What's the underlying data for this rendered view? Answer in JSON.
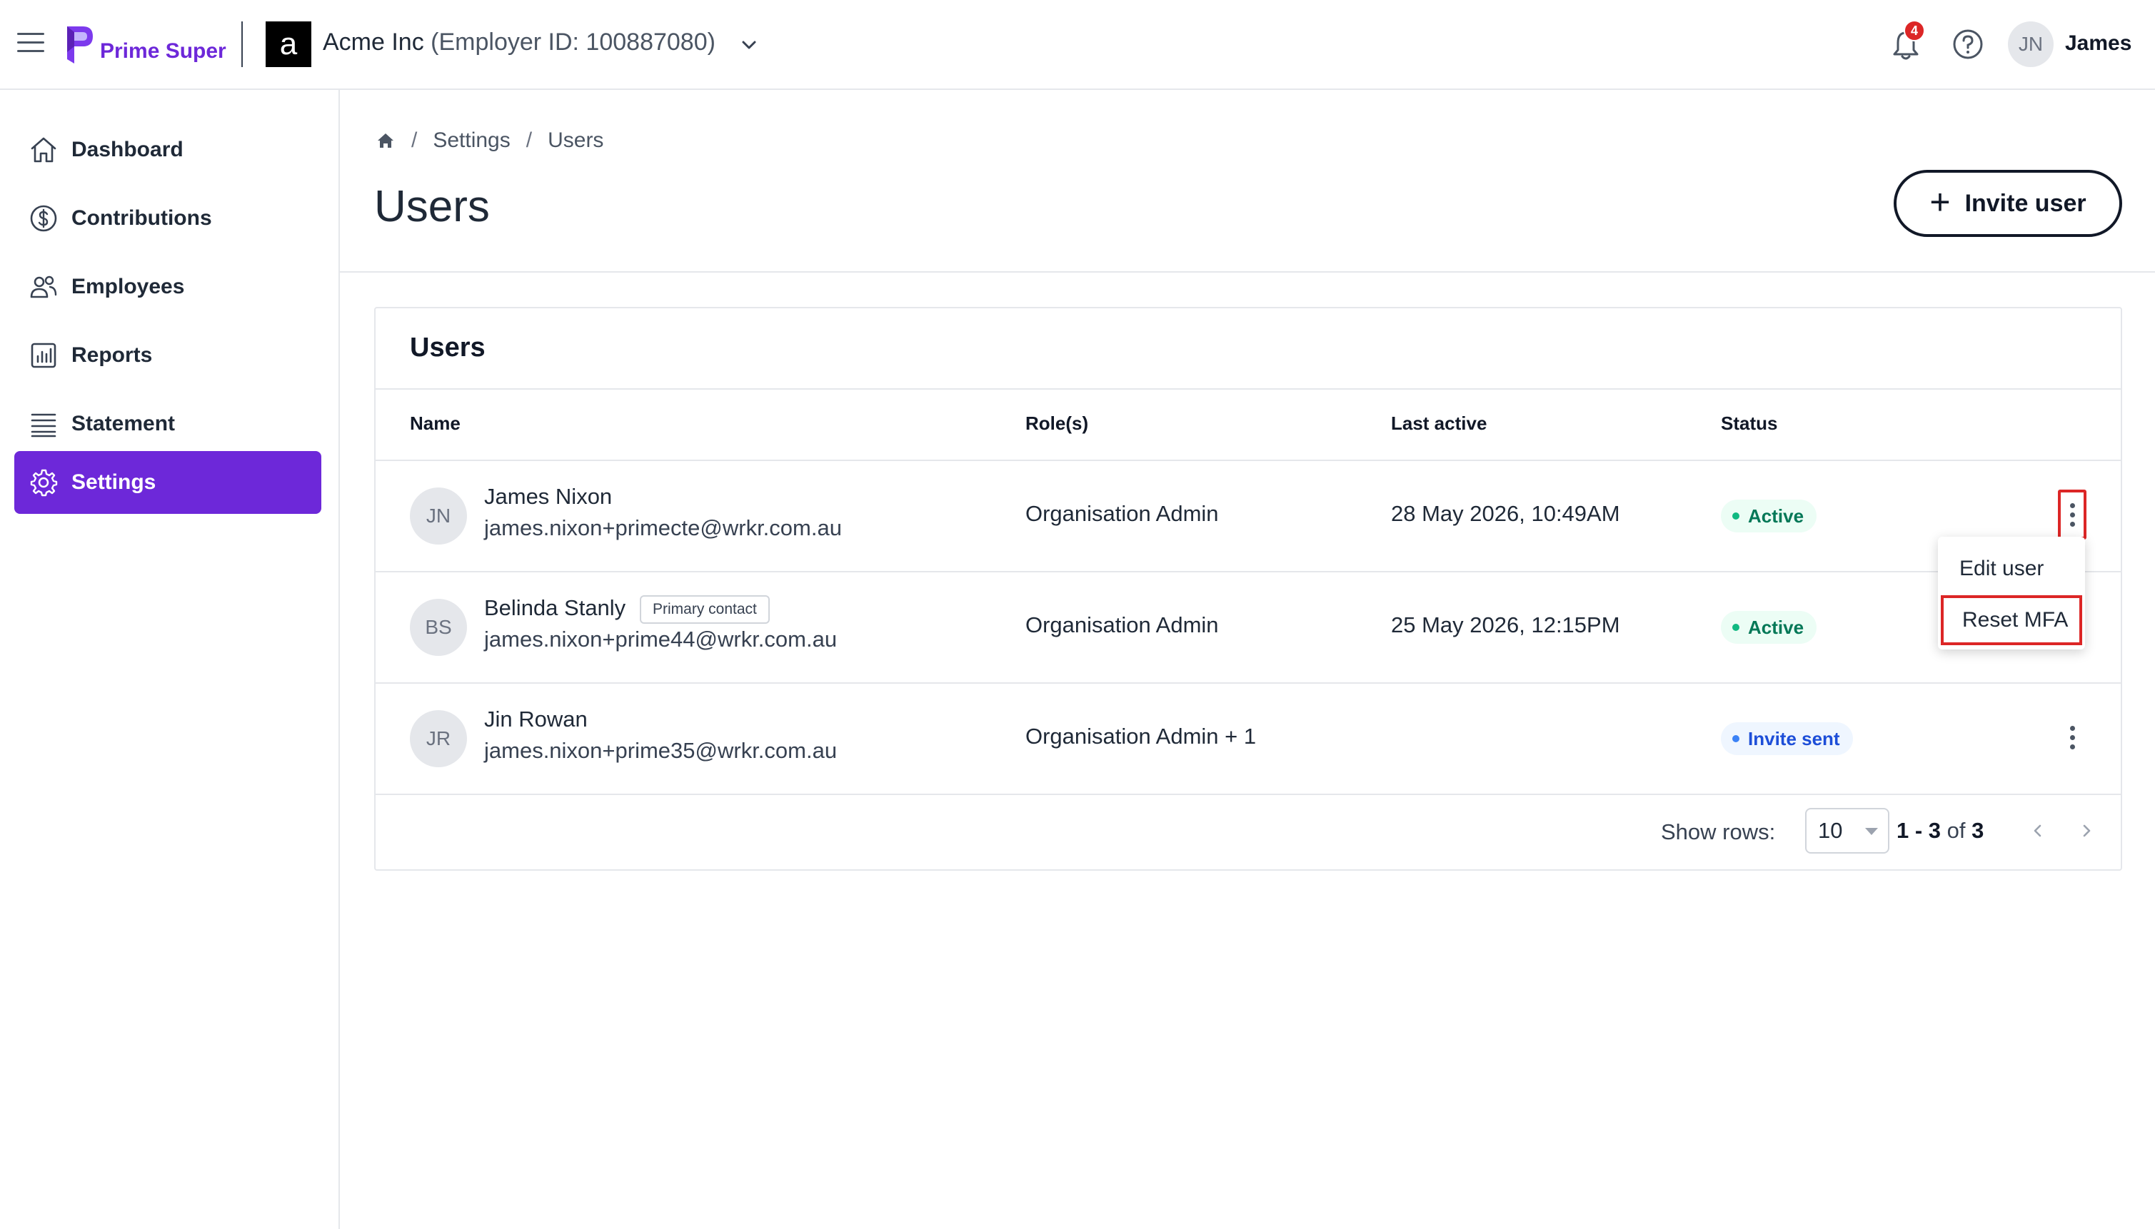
{
  "header": {
    "logo_text": "Prime Super",
    "org_letter": "a",
    "org_name": "Acme Inc",
    "employer_id": "(Employer ID: 100887080)",
    "notification_count": "4",
    "user_initials": "JN",
    "user_name": "James"
  },
  "sidebar": {
    "items": [
      {
        "label": "Dashboard",
        "icon": "home-icon"
      },
      {
        "label": "Contributions",
        "icon": "dollar-circle-icon"
      },
      {
        "label": "Employees",
        "icon": "users-icon"
      },
      {
        "label": "Reports",
        "icon": "bar-chart-icon"
      },
      {
        "label": "Statement",
        "icon": "list-icon"
      },
      {
        "label": "Settings",
        "icon": "gear-icon",
        "active": true
      }
    ]
  },
  "breadcrumb": {
    "items": [
      "Settings",
      "Users"
    ]
  },
  "page": {
    "title": "Users",
    "invite_button": "Invite user"
  },
  "table": {
    "title": "Users",
    "columns": [
      "Name",
      "Role(s)",
      "Last active",
      "Status"
    ],
    "rows": [
      {
        "initials": "JN",
        "name": "James Nixon",
        "email": "james.nixon+primecte@wrkr.com.au",
        "badge": "",
        "role": "Organisation Admin",
        "last_active": "28 May 2026, 10:49AM",
        "status": "Active"
      },
      {
        "initials": "BS",
        "name": "Belinda Stanly",
        "email": "james.nixon+prime44@wrkr.com.au",
        "badge": "Primary contact",
        "role": "Organisation Admin",
        "last_active": "25 May 2026, 12:15PM",
        "status": "Active"
      },
      {
        "initials": "JR",
        "name": "Jin Rowan",
        "email": "james.nixon+prime35@wrkr.com.au",
        "badge": "",
        "role": "Organisation Admin + 1",
        "last_active": "",
        "status": "Invite sent"
      }
    ],
    "show_rows_label": "Show rows:",
    "rows_per_page": "10",
    "range_start_end": "1 - 3",
    "range_of": "of",
    "range_total": "3"
  },
  "menu": {
    "items": [
      "Edit user",
      "Reset MFA"
    ]
  },
  "colors": {
    "brand": "#6d28d9",
    "active_status": "#047857",
    "invite_status": "#1d4ed8",
    "highlight": "#dc2626"
  }
}
